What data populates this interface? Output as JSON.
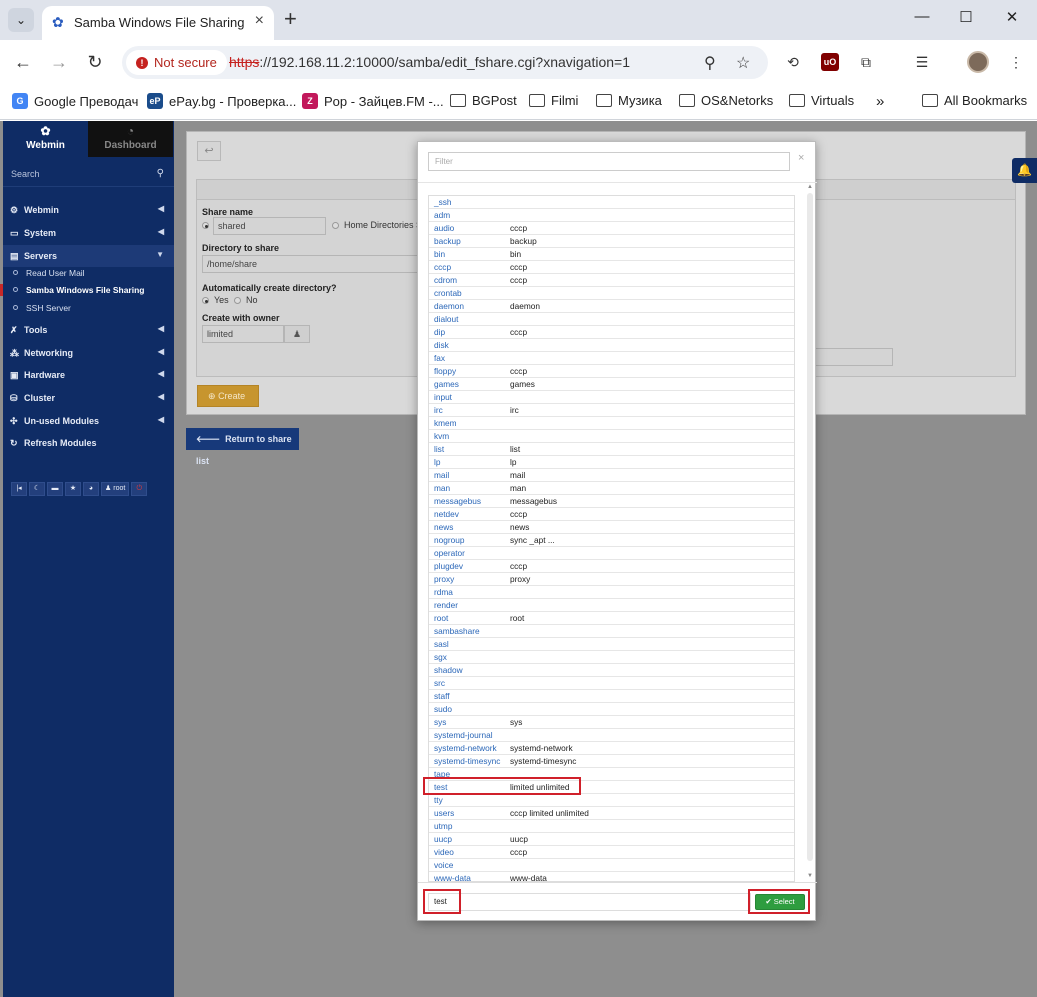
{
  "browser": {
    "tab_title": "Samba Windows File Sharing/C",
    "security_label": "Not secure",
    "url_scheme": "https",
    "url_rest": "://192.168.11.2:10000/samba/edit_fshare.cgi?xnavigation=1",
    "bookmarks": [
      {
        "label": "Google Преводач",
        "icon": "translate-icon",
        "color": "#4285f4"
      },
      {
        "label": "ePay.bg - Проверка...",
        "icon": "epay-icon",
        "color": "#1a4c8b"
      },
      {
        "label": "Pop - Зайцев.FM -...",
        "icon": "zaycev-icon",
        "color": "#c2185b"
      },
      {
        "label": "BGPost",
        "icon": "folder-icon"
      },
      {
        "label": "Filmi",
        "icon": "folder-icon"
      },
      {
        "label": "Музика",
        "icon": "folder-icon"
      },
      {
        "label": "OS&Netorks",
        "icon": "folder-icon"
      },
      {
        "label": "Virtuals",
        "icon": "folder-icon"
      }
    ],
    "more_bookmarks": "»",
    "all_bookmarks": "All Bookmarks"
  },
  "sidebar": {
    "tab_webmin": "Webmin",
    "tab_dashboard": "Dashboard",
    "search_placeholder": "Search",
    "items": [
      {
        "label": "Webmin",
        "icon": "gear-icon"
      },
      {
        "label": "System",
        "icon": "monitor-icon"
      },
      {
        "label": "Servers",
        "icon": "server-icon"
      },
      {
        "label": "Tools",
        "icon": "tools-icon"
      },
      {
        "label": "Networking",
        "icon": "network-icon"
      },
      {
        "label": "Hardware",
        "icon": "hdd-icon"
      },
      {
        "label": "Cluster",
        "icon": "cluster-icon"
      },
      {
        "label": "Un-used Modules",
        "icon": "puzzle-icon"
      },
      {
        "label": "Refresh Modules",
        "icon": "refresh-icon"
      }
    ],
    "subitems": [
      "Read User Mail",
      "Samba Windows File Sharing",
      "SSH Server"
    ],
    "user": "root"
  },
  "form": {
    "share_name_label": "Share name",
    "share_name_value": "shared",
    "home_dirs_label": "Home Directories S",
    "dir_label": "Directory to share",
    "dir_value": "/home/share",
    "auto_create_label": "Automatically create directory?",
    "yes": "Yes",
    "no": "No",
    "owner_label": "Create with owner",
    "owner_value": "limited",
    "create_button": "Create",
    "return_button": "Return to share list"
  },
  "modal": {
    "filter_placeholder": "Filter",
    "close": "×",
    "groups": [
      {
        "group": "_ssh",
        "members": ""
      },
      {
        "group": "adm",
        "members": ""
      },
      {
        "group": "audio",
        "members": "cccp"
      },
      {
        "group": "backup",
        "members": "backup"
      },
      {
        "group": "bin",
        "members": "bin"
      },
      {
        "group": "cccp",
        "members": "cccp"
      },
      {
        "group": "cdrom",
        "members": "cccp"
      },
      {
        "group": "crontab",
        "members": ""
      },
      {
        "group": "daemon",
        "members": "daemon"
      },
      {
        "group": "dialout",
        "members": ""
      },
      {
        "group": "dip",
        "members": "cccp"
      },
      {
        "group": "disk",
        "members": ""
      },
      {
        "group": "fax",
        "members": ""
      },
      {
        "group": "floppy",
        "members": "cccp"
      },
      {
        "group": "games",
        "members": "games"
      },
      {
        "group": "input",
        "members": ""
      },
      {
        "group": "irc",
        "members": "irc"
      },
      {
        "group": "kmem",
        "members": ""
      },
      {
        "group": "kvm",
        "members": ""
      },
      {
        "group": "list",
        "members": "list"
      },
      {
        "group": "lp",
        "members": "lp"
      },
      {
        "group": "mail",
        "members": "mail"
      },
      {
        "group": "man",
        "members": "man"
      },
      {
        "group": "messagebus",
        "members": "messagebus"
      },
      {
        "group": "netdev",
        "members": "cccp"
      },
      {
        "group": "news",
        "members": "news"
      },
      {
        "group": "nogroup",
        "members": "sync _apt ..."
      },
      {
        "group": "operator",
        "members": ""
      },
      {
        "group": "plugdev",
        "members": "cccp"
      },
      {
        "group": "proxy",
        "members": "proxy"
      },
      {
        "group": "rdma",
        "members": ""
      },
      {
        "group": "render",
        "members": ""
      },
      {
        "group": "root",
        "members": "root"
      },
      {
        "group": "sambashare",
        "members": ""
      },
      {
        "group": "sasl",
        "members": ""
      },
      {
        "group": "sgx",
        "members": ""
      },
      {
        "group": "shadow",
        "members": ""
      },
      {
        "group": "src",
        "members": ""
      },
      {
        "group": "staff",
        "members": ""
      },
      {
        "group": "sudo",
        "members": ""
      },
      {
        "group": "sys",
        "members": "sys"
      },
      {
        "group": "systemd-journal",
        "members": ""
      },
      {
        "group": "systemd-network",
        "members": "systemd-network"
      },
      {
        "group": "systemd-timesync",
        "members": "systemd-timesync"
      },
      {
        "group": "tape",
        "members": ""
      },
      {
        "group": "test",
        "members": "limited unlimited"
      },
      {
        "group": "tty",
        "members": ""
      },
      {
        "group": "users",
        "members": "cccp limited unlimited"
      },
      {
        "group": "utmp",
        "members": ""
      },
      {
        "group": "uucp",
        "members": "uucp"
      },
      {
        "group": "video",
        "members": "cccp"
      },
      {
        "group": "voice",
        "members": ""
      },
      {
        "group": "www-data",
        "members": "www-data"
      }
    ],
    "selected_value": "test",
    "select_button": "Select"
  },
  "colors": {
    "sidebar_bg": "#0f2c65",
    "highlight_border": "#d0202a",
    "select_button": "#2e9d3f",
    "create_button": "#c7952e"
  }
}
